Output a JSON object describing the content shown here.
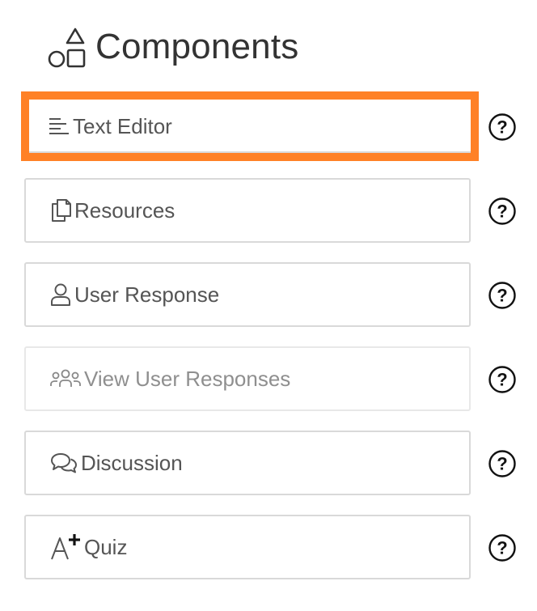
{
  "header": {
    "title": "Components",
    "icon": "shapes-icon"
  },
  "components": [
    {
      "label": "Text Editor",
      "icon": "text-lines-icon",
      "state": "selected"
    },
    {
      "label": "Resources",
      "icon": "documents-icon",
      "state": "enabled"
    },
    {
      "label": "User Response",
      "icon": "user-icon",
      "state": "enabled"
    },
    {
      "label": "View User Responses",
      "icon": "users-group-icon",
      "state": "disabled"
    },
    {
      "label": "Discussion",
      "icon": "chat-bubbles-icon",
      "state": "enabled"
    },
    {
      "label": "Quiz",
      "icon": "a-plus-icon",
      "state": "enabled"
    }
  ],
  "help_icon": "question-circle-icon",
  "colors": {
    "selected_border": "#ff8126",
    "card_border": "#d9d9d9",
    "text": "#555555",
    "disabled_text": "#8f8f8f"
  }
}
